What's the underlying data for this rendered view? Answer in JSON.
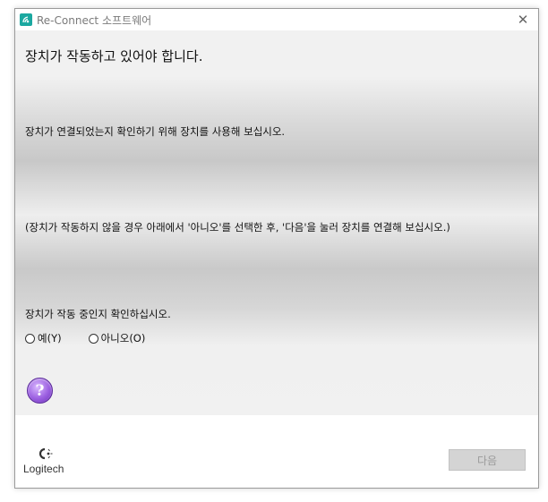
{
  "window": {
    "title": "Re-Connect 소프트웨어",
    "close_glyph": "✕"
  },
  "content": {
    "heading": "장치가 작동하고 있어야 합니다.",
    "line1": "장치가 연결되었는지 확인하기 위해 장치를 사용해 보십시오.",
    "line2": "(장치가 작동하지 않을 경우 아래에서 '아니오'를 선택한 후, '다음'을 눌러 장치를 연결해 보십시오.)",
    "question": "장치가 작동 중인지 확인하십시오.",
    "options": [
      {
        "label": "예(Y)",
        "selected": false
      },
      {
        "label": "아니오(O)",
        "selected": false
      }
    ],
    "help_glyph": "?"
  },
  "footer": {
    "logo_text": "Logitech",
    "next_label": "다음",
    "next_enabled": false
  },
  "colors": {
    "accent_teal": "#1ba8a0",
    "help_purple": "#9b5fe0",
    "disabled_button": "#d4d4d4"
  },
  "icons": [
    "app-icon",
    "close-icon",
    "help-icon",
    "logitech-logo"
  ]
}
